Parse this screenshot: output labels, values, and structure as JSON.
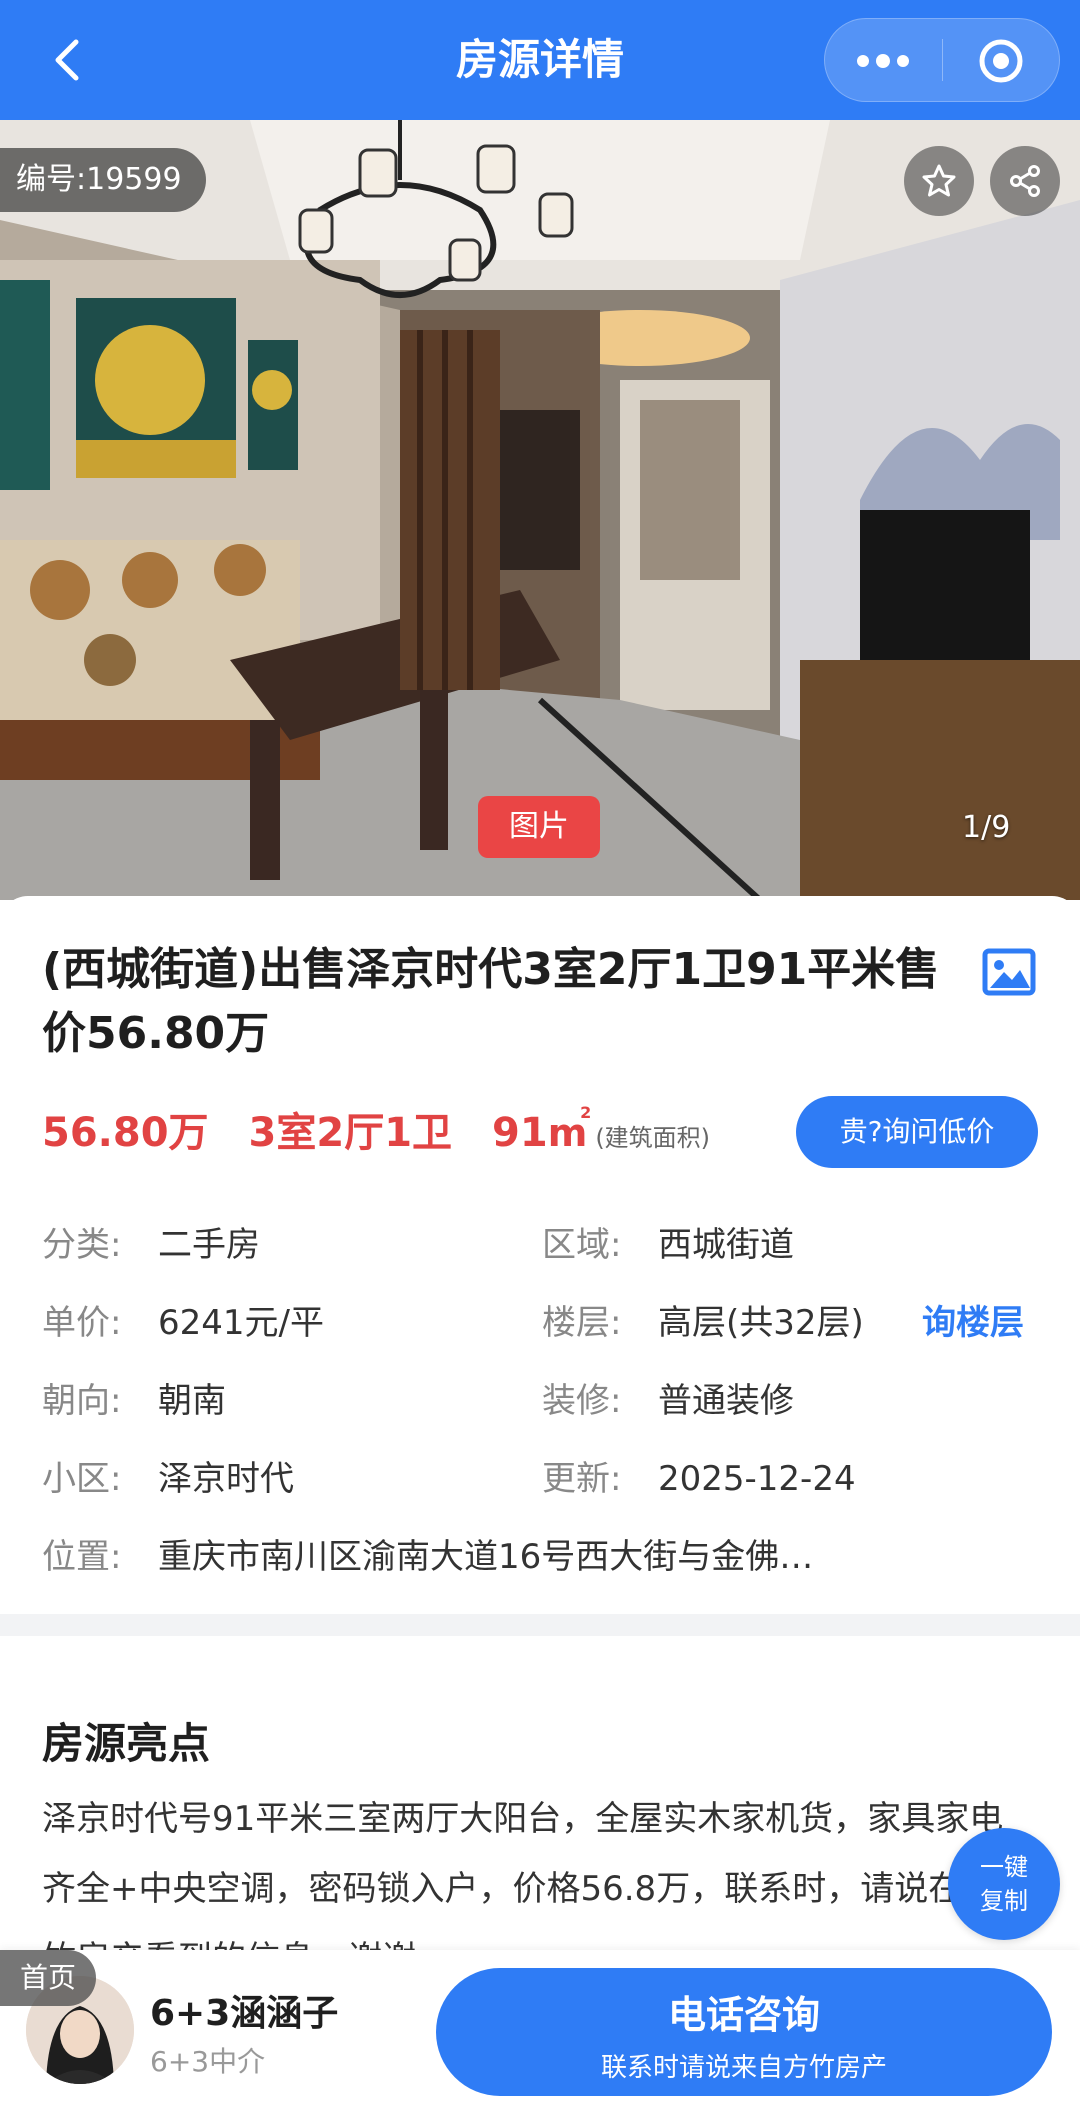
{
  "header": {
    "title": "房源详情",
    "back_icon": "chevron-left-icon",
    "more_icon": "more-dots-icon",
    "target_icon": "target-icon",
    "bg_color": "#2f7cf5"
  },
  "photo": {
    "listing_no": "编号:19599",
    "tag": "图片",
    "counter": "1/9",
    "fav_icon": "star-icon",
    "share_icon": "share-icon"
  },
  "info": {
    "title": "(西城街道)出售泽京时代3室2厅1卫91平米售价56.80万",
    "price": "56.80万",
    "rooms": "3室2厅1卫",
    "area": "91",
    "area_unit": "m",
    "area_unit_sup": "2",
    "area_note": "(建筑面积)",
    "ask_price_button": "贵?询问低价",
    "ask_floor_link": "询楼层",
    "accent_color": "#e14343"
  },
  "details": {
    "category_label": "分类:",
    "category_value": "二手房",
    "region_label": "区域:",
    "region_value": "西城街道",
    "unit_price_label": "单价:",
    "unit_price_value": "6241元/平",
    "floor_label": "楼层:",
    "floor_value": "高层(共32层)",
    "orientation_label": "朝向:",
    "orientation_value": "朝南",
    "decoration_label": "装修:",
    "decoration_value": "普通装修",
    "community_label": "小区:",
    "community_value": "泽京时代",
    "updated_label": "更新:",
    "updated_value": "2025-12-24",
    "location_label": "位置:",
    "location_value": "重庆市南川区渝南大道16号西大街与金佛…"
  },
  "highlights": {
    "heading": "房源亮点",
    "text": "泽京时代号91平米三室两厅大阳台，全屋实木家机货，家具家电齐全+中央空调，密码锁入户，价格56.8万，联系时，请说在方竹房产看到的信息，谢谢",
    "copy_line1": "一键",
    "copy_line2": "复制"
  },
  "bottom": {
    "home_tag": "首页",
    "agent_name": "6+3涵涵子",
    "agent_role": "6+3中介",
    "call_label": "电话咨询",
    "call_sub": "联系时请说来自方竹房产"
  }
}
